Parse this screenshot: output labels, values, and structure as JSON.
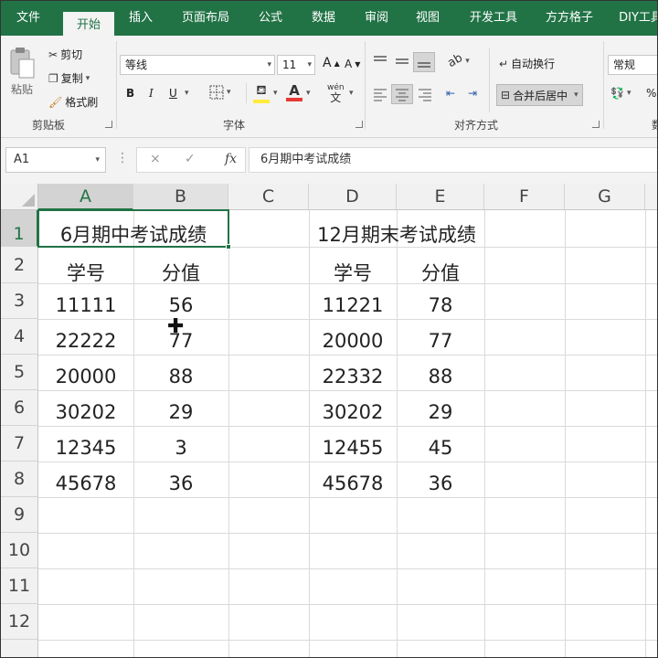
{
  "ribbon_tabs": [
    "文件",
    "开始",
    "插入",
    "页面布局",
    "公式",
    "数据",
    "审阅",
    "视图",
    "开发工具",
    "方方格子",
    "DIY工具"
  ],
  "active_tab": "开始",
  "clipboard": {
    "paste": "粘贴",
    "cut": "剪切",
    "copy": "复制",
    "format_painter": "格式刷",
    "group_label": "剪贴板"
  },
  "font": {
    "name": "等线",
    "size": "11",
    "bold": "B",
    "italic": "I",
    "underline": "U",
    "grow": "A",
    "shrink": "A",
    "fill_color": "#ffeb3b",
    "font_color": "#e53935",
    "phonetic": "wén",
    "group_label": "字体"
  },
  "alignment": {
    "wrap_text": "自动换行",
    "merge_center": "合并后居中",
    "group_label": "对齐方式"
  },
  "number": {
    "format": "常规",
    "percent": "%",
    "group_label_partial": "数"
  },
  "formula_bar": {
    "name_box": "A1",
    "content": "6月期中考试成绩",
    "cancel": "×",
    "enter": "✓",
    "fx": "fx"
  },
  "sheet": {
    "columns": [
      "A",
      "B",
      "C",
      "D",
      "E",
      "F",
      "G"
    ],
    "rows": [
      "1",
      "2",
      "3",
      "4",
      "5",
      "6",
      "7",
      "8",
      "9",
      "10",
      "11",
      "12"
    ],
    "selected_cell": "A1",
    "left_table": {
      "title": "6月期中考试成绩",
      "headers": [
        "学号",
        "分值"
      ],
      "rows": [
        [
          "11111",
          "56"
        ],
        [
          "22222",
          "77"
        ],
        [
          "20000",
          "88"
        ],
        [
          "30202",
          "29"
        ],
        [
          "12345",
          "3"
        ],
        [
          "45678",
          "36"
        ]
      ]
    },
    "right_table": {
      "title": "12月期末考试成绩",
      "headers": [
        "学号",
        "分值"
      ],
      "rows": [
        [
          "11221",
          "78"
        ],
        [
          "20000",
          "77"
        ],
        [
          "22332",
          "88"
        ],
        [
          "30202",
          "29"
        ],
        [
          "12455",
          "45"
        ],
        [
          "45678",
          "36"
        ]
      ]
    }
  },
  "colors": {
    "excel_green": "#217346",
    "ribbon_bg": "#f3f3f3"
  }
}
